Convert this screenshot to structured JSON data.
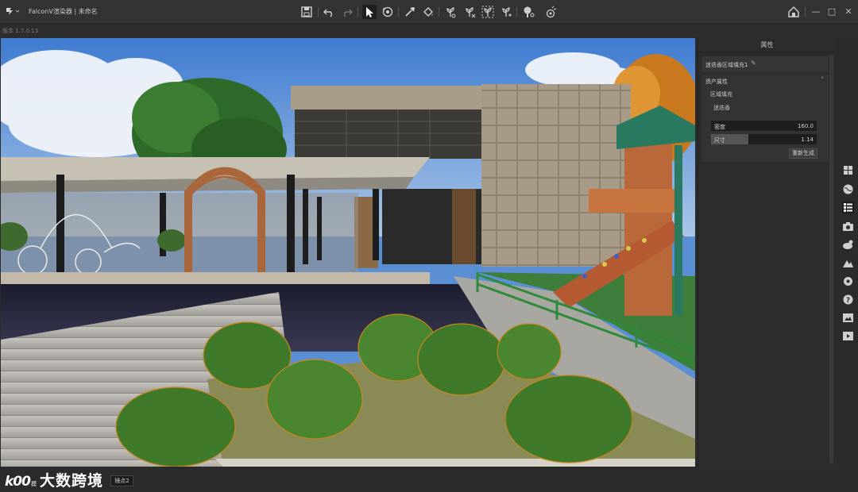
{
  "app": {
    "title": "FalconV渲染器 | 未命名",
    "version": "版本 1.7.0.13"
  },
  "toolbar": {
    "icons": [
      "save-icon",
      "undo-icon",
      "redo-icon",
      "select-arrow-icon",
      "view-rotate-icon",
      "eyedropper-icon",
      "paint-bucket-icon",
      "plant-brush-icon",
      "plant-erase-icon",
      "plant-scatter-icon",
      "plant-adjust-icon",
      "tree-icon",
      "particle-icon"
    ]
  },
  "window_controls": {
    "home": "⌂",
    "minimize": "—",
    "maximize": "□",
    "close": "✕"
  },
  "properties_panel": {
    "header": "属性",
    "object_name": "迷迭香区域填充1",
    "asset_section_title": "资产属性",
    "fill_title": "区域填充",
    "plant_name": "迷迭香",
    "density": {
      "label": "密度",
      "value": "160.0",
      "fraction": 0.0
    },
    "size": {
      "label": "尺寸",
      "value": "1.14",
      "fraction": 0.35
    },
    "regenerate_label": "重新生成"
  },
  "side_toolbar": {
    "icons": [
      "grid-icon",
      "globe-icon",
      "list-icon",
      "camera-icon",
      "weather-icon",
      "terrain-icon",
      "settings-icon",
      "help-icon",
      "image-icon",
      "video-icon"
    ],
    "active_index": 2
  },
  "bottom": {
    "camera_tab": "镜点2",
    "watermark_logo": "k00",
    "watermark_small": "模",
    "watermark_text": "大数跨境"
  },
  "colors": {
    "accent": "#3e3e3e",
    "panel": "#2c2c2c",
    "titlebar": "#333333"
  }
}
